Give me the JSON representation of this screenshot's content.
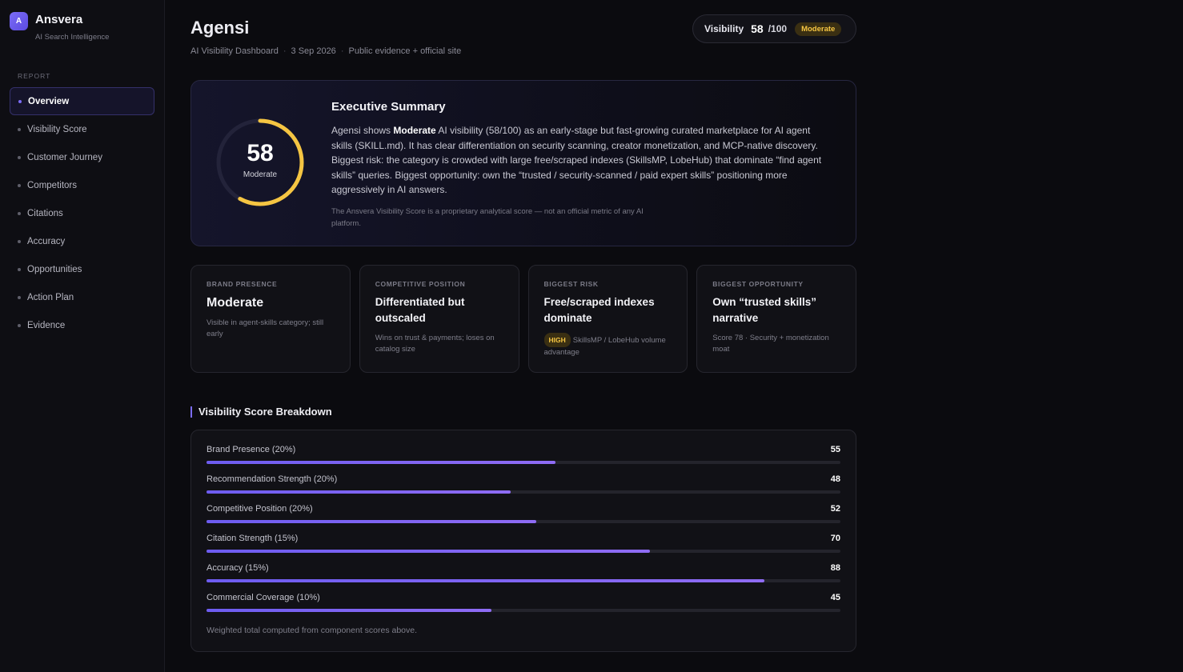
{
  "brand": {
    "logo_letter": "A",
    "name": "Ansvera",
    "tagline": "AI Search Intelligence"
  },
  "sidebar": {
    "section_label": "REPORT",
    "items": [
      {
        "label": "Overview",
        "active": true
      },
      {
        "label": "Visibility Score"
      },
      {
        "label": "Customer Journey"
      },
      {
        "label": "Competitors"
      },
      {
        "label": "Citations"
      },
      {
        "label": "Accuracy"
      },
      {
        "label": "Opportunities"
      },
      {
        "label": "Action Plan"
      },
      {
        "label": "Evidence"
      }
    ]
  },
  "header": {
    "title": "Agensi",
    "meta": [
      "AI Visibility Dashboard",
      "3 Sep 2026",
      "Public evidence + official site"
    ],
    "meta_sep": "·",
    "visibility": {
      "label": "Visibility",
      "score": "58",
      "max": "/100",
      "level": "Moderate"
    }
  },
  "executive": {
    "gauge": {
      "score": "58",
      "label": "Moderate",
      "fraction": 0.58
    },
    "title": "Executive Summary",
    "text_before": "Agensi shows ",
    "text_bold": "Moderate",
    "text_after": " AI visibility (58/100) as an early-stage but fast-growing curated marketplace for AI agent skills (SKILL.md). It has clear differentiation on security scanning, creator monetization, and MCP-native discovery. Biggest risk: the category is crowded with large free/scraped indexes (SkillsMP, LobeHub) that dominate “find agent skills” queries. Biggest opportunity: own the “trusted / security-scanned / paid expert skills” positioning more aggressively in AI answers.",
    "note": "The Ansvera Visibility Score is a proprietary analytical score — not an official metric of any AI platform."
  },
  "cards": [
    {
      "label": "BRAND PRESENCE",
      "title": "Moderate",
      "desc": "Visible in agent-skills category; still early"
    },
    {
      "label": "COMPETITIVE POSITION",
      "title": "Differentiated but outscaled",
      "desc": "Wins on trust & payments; loses on catalog size"
    },
    {
      "label": "BIGGEST RISK",
      "title": "Free/scraped indexes dominate",
      "badge": "HIGH",
      "desc": "SkillsMP / LobeHub volume advantage"
    },
    {
      "label": "BIGGEST OPPORTUNITY",
      "title": "Own “trusted skills” narrative",
      "desc": "Score 78 · Security + monetization moat"
    }
  ],
  "breakdown": {
    "title": "Visibility Score Breakdown",
    "rows": [
      {
        "label": "Brand Presence (20%)",
        "value": 55
      },
      {
        "label": "Recommendation Strength (20%)",
        "value": 48
      },
      {
        "label": "Competitive Position (20%)",
        "value": 52
      },
      {
        "label": "Citation Strength (15%)",
        "value": 70
      },
      {
        "label": "Accuracy (15%)",
        "value": 88
      },
      {
        "label": "Commercial Coverage (10%)",
        "value": 45
      }
    ],
    "footnote": "Weighted total computed from component scores above."
  },
  "colors": {
    "accent": "#7b6cf6",
    "gauge": "#f5c542",
    "moderate_badge": "#f5c542"
  }
}
